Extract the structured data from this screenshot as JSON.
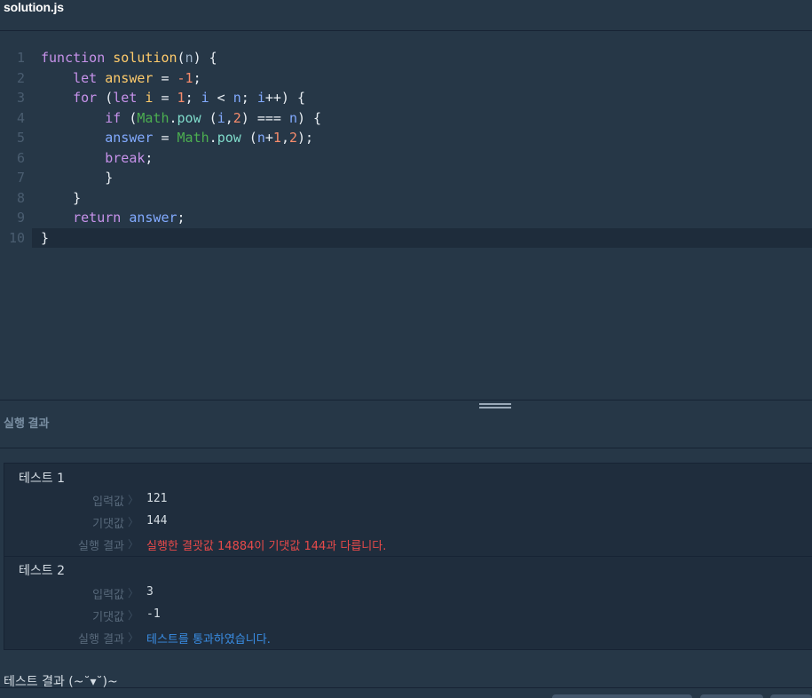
{
  "file": {
    "name": "solution.js"
  },
  "editor": {
    "lines": [
      {
        "n": "1",
        "tokens": [
          [
            "kw",
            "function"
          ],
          [
            "pun",
            " "
          ],
          [
            "fn",
            "solution"
          ],
          [
            "pun",
            "("
          ],
          [
            "par",
            "n"
          ],
          [
            "pun",
            ") {"
          ]
        ]
      },
      {
        "n": "2",
        "tokens": [
          [
            "pun",
            "    "
          ],
          [
            "kw",
            "let"
          ],
          [
            "pun",
            " "
          ],
          [
            "fn",
            "answer"
          ],
          [
            "pun",
            " = "
          ],
          [
            "num",
            "-1"
          ],
          [
            "pun",
            ";"
          ]
        ]
      },
      {
        "n": "3",
        "tokens": [
          [
            "pun",
            "    "
          ],
          [
            "kw",
            "for"
          ],
          [
            "pun",
            " ("
          ],
          [
            "kw",
            "let"
          ],
          [
            "pun",
            " "
          ],
          [
            "fn",
            "i"
          ],
          [
            "pun",
            " = "
          ],
          [
            "num",
            "1"
          ],
          [
            "pun",
            "; "
          ],
          [
            "var",
            "i"
          ],
          [
            "pun",
            " < "
          ],
          [
            "var",
            "n"
          ],
          [
            "pun",
            "; "
          ],
          [
            "var",
            "i"
          ],
          [
            "pun",
            "++) {"
          ]
        ]
      },
      {
        "n": "4",
        "tokens": [
          [
            "pun",
            "        "
          ],
          [
            "kw",
            "if"
          ],
          [
            "pun",
            " ("
          ],
          [
            "cls",
            "Math"
          ],
          [
            "pun",
            "."
          ],
          [
            "met",
            "pow"
          ],
          [
            "pun",
            " ("
          ],
          [
            "var",
            "i"
          ],
          [
            "pun",
            ","
          ],
          [
            "num",
            "2"
          ],
          [
            "pun",
            ") === "
          ],
          [
            "var",
            "n"
          ],
          [
            "pun",
            ") {"
          ]
        ]
      },
      {
        "n": "5",
        "tokens": [
          [
            "pun",
            "        "
          ],
          [
            "var",
            "answer"
          ],
          [
            "pun",
            " = "
          ],
          [
            "cls",
            "Math"
          ],
          [
            "pun",
            "."
          ],
          [
            "met",
            "pow"
          ],
          [
            "pun",
            " ("
          ],
          [
            "var",
            "n"
          ],
          [
            "pun",
            "+"
          ],
          [
            "num",
            "1"
          ],
          [
            "pun",
            ","
          ],
          [
            "num",
            "2"
          ],
          [
            "pun",
            ");"
          ]
        ]
      },
      {
        "n": "6",
        "tokens": [
          [
            "pun",
            "        "
          ],
          [
            "kw",
            "break"
          ],
          [
            "pun",
            ";"
          ]
        ]
      },
      {
        "n": "7",
        "tokens": [
          [
            "pun",
            "        }"
          ]
        ]
      },
      {
        "n": "8",
        "tokens": [
          [
            "pun",
            "    }"
          ]
        ]
      },
      {
        "n": "9",
        "tokens": [
          [
            "pun",
            "    "
          ],
          [
            "kw",
            "return"
          ],
          [
            "pun",
            " "
          ],
          [
            "var",
            "answer"
          ],
          [
            "pun",
            ";"
          ]
        ]
      },
      {
        "n": "10",
        "tokens": [
          [
            "pun",
            "}"
          ]
        ]
      }
    ]
  },
  "results": {
    "header": "실행 결과",
    "tests": [
      {
        "title": "테스트 1",
        "input_label": "입력값",
        "input": "121",
        "expected_label": "기댓값",
        "expected": "144",
        "result_label": "실행 결과",
        "result": "실행한 결괏값 14884이 기댓값 144과 다릅니다.",
        "status": "fail"
      },
      {
        "title": "테스트 2",
        "input_label": "입력값",
        "input": "3",
        "expected_label": "기댓값",
        "expected": "-1",
        "result_label": "실행 결과",
        "result": "테스트를 통과하였습니다.",
        "status": "pass"
      }
    ],
    "chevron": "〉",
    "final": "테스트 결과 (~˘▾˘)~"
  }
}
